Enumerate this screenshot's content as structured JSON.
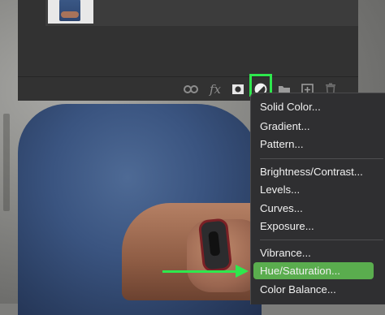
{
  "toolbar": {
    "icons": [
      "link-layers-icon",
      "fx-icon",
      "add-mask-icon",
      "adjustment-layer-icon",
      "new-group-icon",
      "new-layer-icon",
      "delete-layer-icon"
    ],
    "fx_label": "fx"
  },
  "menu": {
    "groups": [
      [
        "Solid Color...",
        "Gradient...",
        "Pattern..."
      ],
      [
        "Brightness/Contrast...",
        "Levels...",
        "Curves...",
        "Exposure..."
      ],
      [
        "Vibrance...",
        "Hue/Saturation...",
        "Color Balance..."
      ]
    ],
    "selected": "Hue/Saturation..."
  },
  "colors": {
    "highlight": "#2ee84d",
    "selected_item": "#5aad4e",
    "menu_bg": "#2f2f31",
    "panel_bg": "#323232"
  }
}
